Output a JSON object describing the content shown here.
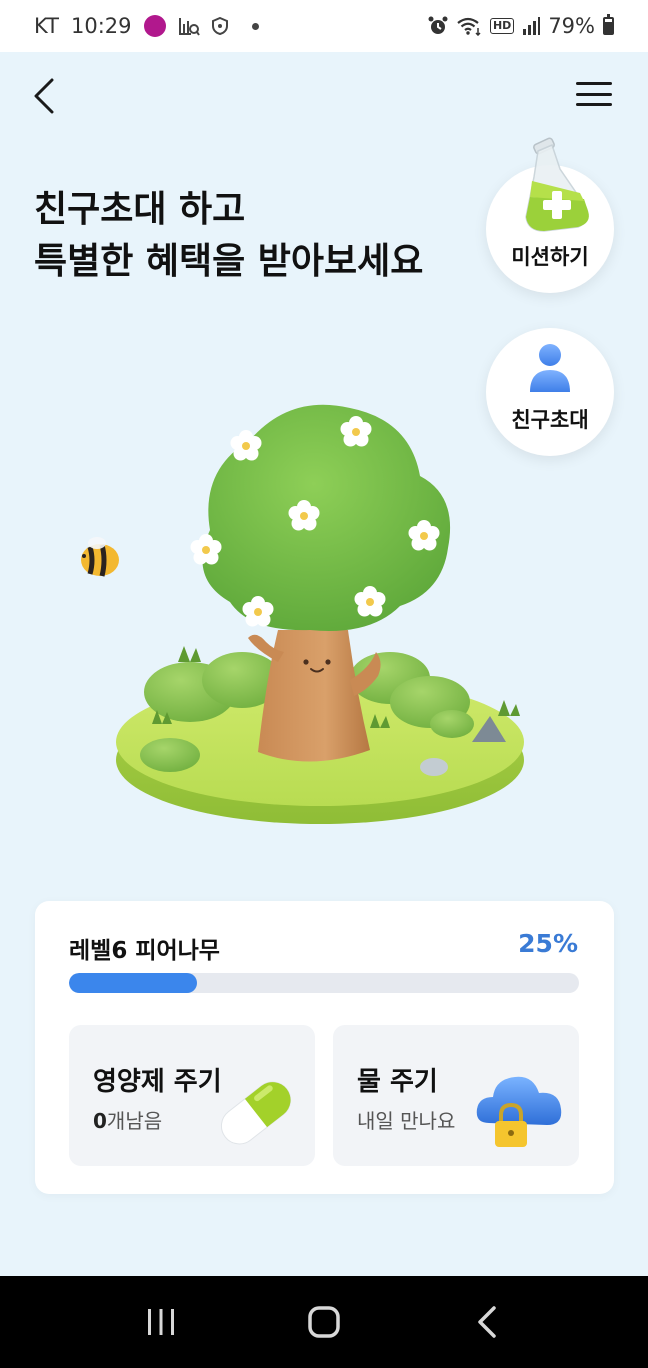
{
  "status_bar": {
    "carrier": "KT",
    "time": "10:29",
    "hd_label": "HD",
    "battery": "79%"
  },
  "header": {
    "back_icon": "chevron-left-icon",
    "menu_icon": "hamburger-menu-icon"
  },
  "headline": {
    "line1": "친구초대 하고",
    "line2": "특별한 혜택을 받아보세요"
  },
  "floating_buttons": {
    "mission_label": "미션하기",
    "invite_label": "친구초대"
  },
  "level_card": {
    "level_label": "레벨6 피어나무",
    "progress_text": "25%",
    "progress_value": 0.25,
    "accent_color": "#3b86ec"
  },
  "actions": {
    "nutrient": {
      "title": "영양제 주기",
      "remaining_count": "0",
      "remaining_suffix": "개남음"
    },
    "water": {
      "title": "물 주기",
      "subtitle": "내일 만나요"
    }
  }
}
